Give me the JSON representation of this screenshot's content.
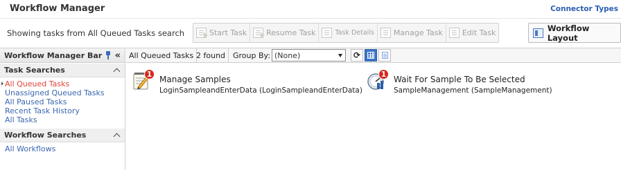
{
  "app": {
    "title": "Workflow Manager",
    "connector_link": "Connector Types"
  },
  "toolbar": {
    "search_status": "Showing tasks from All Queued Tasks search",
    "buttons": [
      {
        "label": "Start Task",
        "icon": "start-task-icon",
        "enabled": false
      },
      {
        "label": "Resume Task",
        "icon": "resume-task-icon",
        "enabled": false
      },
      {
        "label": "Task Details",
        "icon": "task-details-icon",
        "enabled": false
      },
      {
        "label": "Manage Task",
        "icon": "manage-task-icon",
        "enabled": false
      },
      {
        "label": "Edit Task",
        "icon": "edit-task-icon",
        "enabled": false
      }
    ],
    "layout_button": "Workflow Layout"
  },
  "sidebar": {
    "title": "Workflow Manager Bar",
    "collapse_glyph": "«",
    "sections": [
      {
        "title": "Task Searches",
        "items": [
          "All Queued Tasks",
          "Unassigned Queued Tasks",
          "All Paused Tasks",
          "Recent Task History",
          "All Tasks"
        ],
        "active_index": 0
      },
      {
        "title": "Workflow Searches",
        "items": [
          "All Workflows"
        ]
      }
    ]
  },
  "main": {
    "search_name": "All Queued Tasks",
    "found_count": "2 found",
    "group_by_label": "Group By:",
    "group_by_value": "(None)",
    "tasks": [
      {
        "name": "Manage Samples",
        "sub": "LoginSampleandEnterData (LoginSampleandEnterData)",
        "badge": "1",
        "icon": "notepad-pencil-icon"
      },
      {
        "name": "Wait For Sample To Be Selected",
        "sub": "SampleManagement (SampleManagement)",
        "badge": "1",
        "icon": "gauge-icon"
      }
    ]
  },
  "colors": {
    "link": "#3a66b0",
    "active_link": "#e0443a",
    "badge": "#d9261c",
    "accent": "#3a74c8"
  }
}
